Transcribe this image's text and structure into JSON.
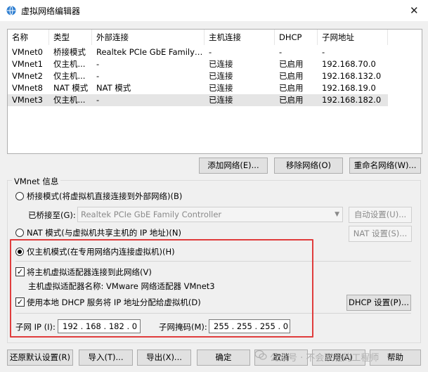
{
  "window": {
    "title": "虚拟网络编辑器",
    "close_glyph": "✕"
  },
  "table": {
    "columns": [
      "名称",
      "类型",
      "外部连接",
      "主机连接",
      "DHCP",
      "子网地址"
    ],
    "rows": [
      [
        "VMnet0",
        "桥接模式",
        "Realtek PCIe GbE Family Co...",
        "-",
        "-",
        "-"
      ],
      [
        "VMnet1",
        "仅主机...",
        "-",
        "已连接",
        "已启用",
        "192.168.70.0"
      ],
      [
        "VMnet2",
        "仅主机...",
        "-",
        "已连接",
        "已启用",
        "192.168.132.0"
      ],
      [
        "VMnet8",
        "NAT 模式",
        "NAT 模式",
        "已连接",
        "已启用",
        "192.168.19.0"
      ],
      [
        "VMnet3",
        "仅主机...",
        "-",
        "已连接",
        "已启用",
        "192.168.182.0"
      ]
    ],
    "selected_row": 4
  },
  "table_buttons": {
    "add": "添加网络(E)...",
    "remove": "移除网络(O)",
    "rename": "重命名网络(W)..."
  },
  "vmnet_info": {
    "group_title": "VMnet 信息",
    "bridged_label": "桥接模式(将虚拟机直接连接到外部网络)(B)",
    "bridged_to_label": "已桥接至(G):",
    "bridged_to_value": "Realtek PCIe GbE Family Controller",
    "auto_settings": "自动设置(U)...",
    "nat_label": "NAT 模式(与虚拟机共享主机的 IP 地址)(N)",
    "nat_settings": "NAT 设置(S)...",
    "host_only_label": "仅主机模式(在专用网络内连接虚拟机)(H)",
    "connect_adapter_label": "将主机虚拟适配器连接到此网络(V)",
    "adapter_name_text": "主机虚拟适配器名称: VMware 网络适配器 VMnet3",
    "use_dhcp_label": "使用本地 DHCP 服务将 IP 地址分配给虚拟机(D)",
    "dhcp_settings": "DHCP 设置(P)...",
    "subnet_ip_label": "子网 IP (I):",
    "subnet_ip_value": "192 . 168 . 182 .  0",
    "subnet_mask_label": "子网掩码(M):",
    "subnet_mask_value": "255 . 255 . 255 .  0",
    "mode": "host-only",
    "connect_adapter_checked": true,
    "use_dhcp_checked": true
  },
  "footer": {
    "restore": "还原默认设置(R)",
    "import": "导入(T)...",
    "export": "导出(X)...",
    "ok": "确定",
    "cancel": "取消",
    "apply": "应用(A)",
    "help": "帮助"
  },
  "watermark": "公众号 · 不会联发的工程师",
  "colors": {
    "highlight": "#e03c3c",
    "selected_row": "#e5e5e5"
  }
}
